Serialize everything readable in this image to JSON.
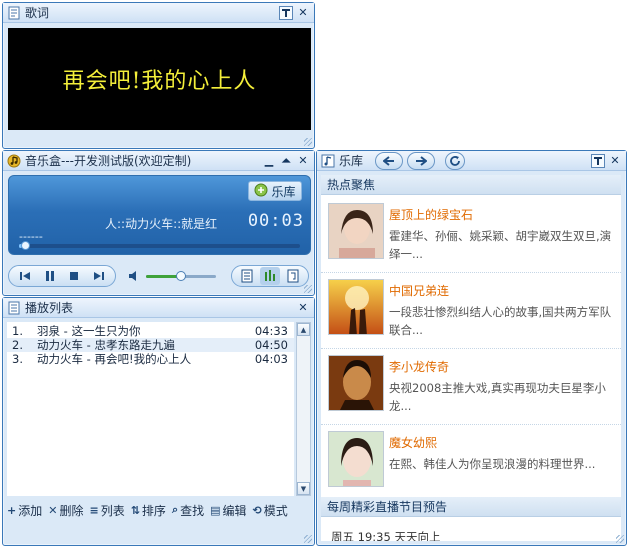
{
  "lyrics": {
    "title": "歌词",
    "current_line": "再会吧!我的心上人"
  },
  "player": {
    "title": "音乐盒---开发测试版(欢迎定制)",
    "library_button": "乐库",
    "marquee": "人::动力火车::就是红",
    "time": "00:03",
    "dash_text": "------",
    "progress": 0.01,
    "volume": 0.5
  },
  "playlist": {
    "title": "播放列表",
    "tracks": [
      {
        "num": "1.",
        "title": "羽泉 - 这一生只为你",
        "duration": "04:33"
      },
      {
        "num": "2.",
        "title": "动力火车 - 忠孝东路走九遍",
        "duration": "04:50"
      },
      {
        "num": "3.",
        "title": "动力火车 - 再会吧!我的心上人",
        "duration": "04:03"
      }
    ],
    "toolbar": {
      "add": "添加",
      "delete": "删除",
      "list": "列表",
      "sort": "排序",
      "find": "查找",
      "edit": "编辑",
      "mode": "模式"
    }
  },
  "library": {
    "title": "乐库",
    "section_hot": "热点聚焦",
    "items": [
      {
        "title": "屋顶上的绿宝石",
        "desc": "霍建华、孙俪、姚采颖、胡宇崴双生双旦,演绎一..."
      },
      {
        "title": "中国兄弟连",
        "desc": "一段悲壮惨烈纠结人心的故事,国共两方军队联合..."
      },
      {
        "title": "李小龙传奇",
        "desc": "央视2008主推大戏,真实再现功夫巨星李小龙..."
      },
      {
        "title": "魔女幼熙",
        "desc": "在熙、韩佳人为你呈现浪漫的料理世界..."
      }
    ],
    "section_schedule": "每周精彩直播节目预告",
    "schedule_line": "周五 19:35 天天向上"
  },
  "colors": {
    "accent_blue": "#3a78b8",
    "lyrics_yellow": "#f4ef3a",
    "news_title_orange": "#e06a00"
  }
}
